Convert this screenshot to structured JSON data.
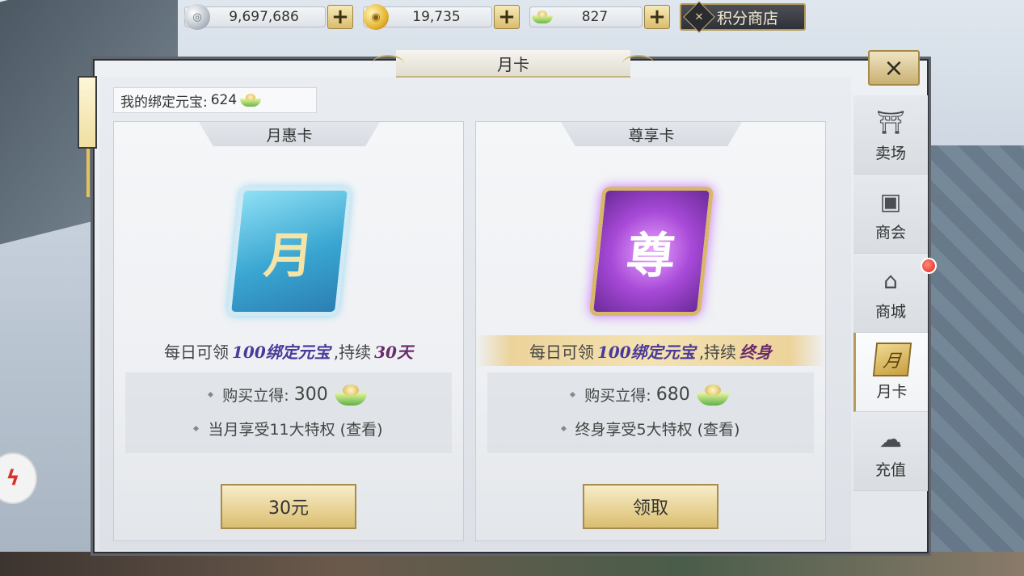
{
  "currencies": [
    {
      "icon": "silver-coin-icon",
      "value": "9,697,686"
    },
    {
      "icon": "gold-coin-icon",
      "value": "19,735"
    },
    {
      "icon": "jade-ingot-icon",
      "value": "827"
    }
  ],
  "plus_label": "+",
  "points_shop_label": "积分商店",
  "points_shop_icon_text": "",
  "window_title": "月卡",
  "close_label": "×",
  "balance": {
    "label": "我的绑定元宝:",
    "value": "624"
  },
  "cards": [
    {
      "name": "月惠卡",
      "card_glyph": "月",
      "desc_prefix": "每日可领",
      "desc_amount": "100绑定元宝",
      "desc_mid": ",持续",
      "desc_duration": "30天",
      "buy_prefix": "购买立得:",
      "buy_value": "300",
      "privilege": "当月享受11大特权 (查看)",
      "button": "30元"
    },
    {
      "name": "尊享卡",
      "card_glyph": "尊",
      "desc_prefix": "每日可领",
      "desc_amount": "100绑定元宝",
      "desc_mid": ",持续",
      "desc_duration": "终身",
      "buy_prefix": "购买立得:",
      "buy_value": "680",
      "privilege": "终身享受5大特权 (查看)",
      "button": "领取"
    }
  ],
  "tabs": [
    {
      "label": "卖场",
      "icon": "market-icon",
      "glyph": "⛩"
    },
    {
      "label": "商会",
      "icon": "guild-icon",
      "glyph": "▣"
    },
    {
      "label": "商城",
      "icon": "mall-icon",
      "glyph": "⌂"
    },
    {
      "label": "月卡",
      "icon": "month-card-icon",
      "glyph": "月"
    },
    {
      "label": "充值",
      "icon": "recharge-icon",
      "glyph": "☁"
    }
  ],
  "active_tab": "月卡",
  "colors": {
    "accent_gold": "#c9ad63",
    "purple_text": "#4a3a9a",
    "notify_red": "#e3241a"
  }
}
